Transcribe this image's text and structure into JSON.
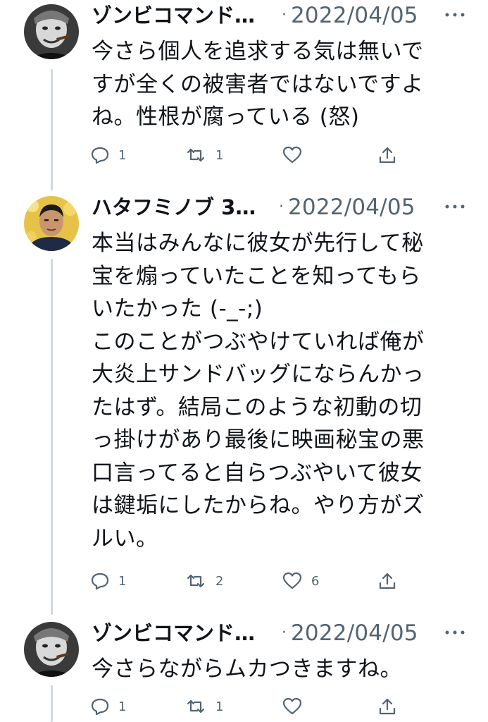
{
  "tweets": [
    {
      "author": "ゾンビコマンド…",
      "separator": "·",
      "date": "2022/04/05",
      "lines": [
        "今さら個人を追求する気は無いで",
        "すが全くの被害者ではないですよ",
        "ね。性根が腐っている (怒)"
      ],
      "replies": "1",
      "retweets": "1",
      "likes": "",
      "avatar_icon": "grayscale-man-cigar-avatar"
    },
    {
      "author": "ハタフミノブ 3…",
      "separator": "·",
      "date": "2022/04/05",
      "lines": [
        "本当はみんなに彼女が先行して秘",
        "宝を煽っていたことを知ってもら",
        "いたかった (-_-;)",
        "このことがつぶやけていれば俺が",
        "大炎上サンドバッグにならんかっ",
        "たはず。結局このような初動の切",
        "っ掛けがあり最後に映画秘宝の悪",
        "口言ってると自らつぶやいて彼女",
        "は鍵垢にしたからね。やり方がズ",
        "ルい。"
      ],
      "replies": "1",
      "retweets": "2",
      "likes": "6",
      "avatar_icon": "man-gold-background-avatar"
    },
    {
      "author": "ゾンビコマンド…",
      "separator": "·",
      "date": "2022/04/05",
      "lines": [
        "今さらながらムカつきますね。"
      ],
      "replies": "1",
      "retweets": "1",
      "likes": "",
      "avatar_icon": "grayscale-man-cigar-avatar"
    }
  ],
  "icons": {
    "reply": "reply-bubble-icon",
    "retweet": "retweet-arrows-icon",
    "like": "heart-icon",
    "share": "share-upload-icon",
    "more": "more-dots-icon"
  },
  "colors": {
    "text": "#0f1419",
    "muted": "#536471",
    "thread_line": "#cfd9de",
    "background": "#ffffff"
  }
}
